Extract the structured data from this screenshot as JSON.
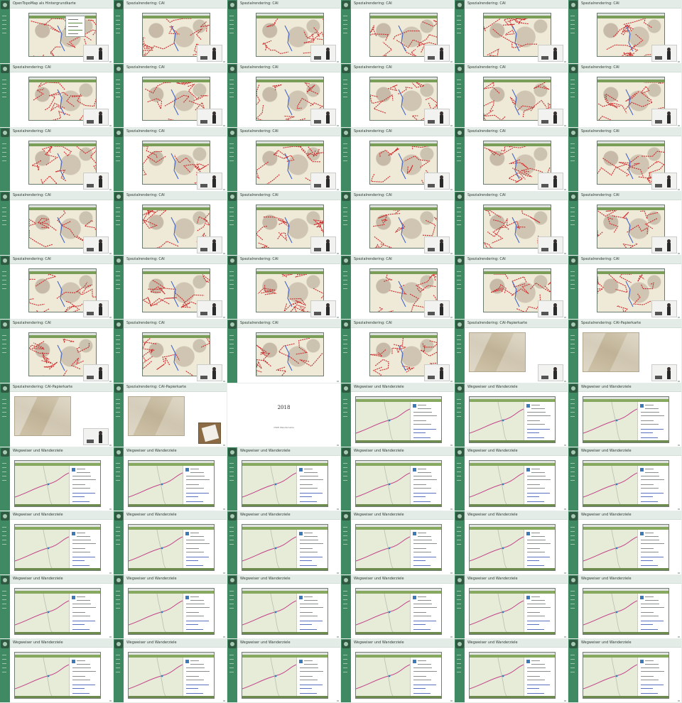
{
  "contact_sheet": {
    "slides": [
      {
        "title": "OpenTopoMap als Hintergrundkarte",
        "kind": "map-legend"
      },
      {
        "title": "Spezialrendering: CAI",
        "kind": "map"
      },
      {
        "title": "Spezialrendering: CAI",
        "kind": "map"
      },
      {
        "title": "Spezialrendering: CAI",
        "kind": "map"
      },
      {
        "title": "Spezialrendering: CAI",
        "kind": "map"
      },
      {
        "title": "Spezialrendering: CAI",
        "kind": "map"
      },
      {
        "title": "Spezialrendering: CAI",
        "kind": "map"
      },
      {
        "title": "Spezialrendering: CAI",
        "kind": "map"
      },
      {
        "title": "Spezialrendering: CAI",
        "kind": "map"
      },
      {
        "title": "Spezialrendering: CAI",
        "kind": "map"
      },
      {
        "title": "Spezialrendering: CAI",
        "kind": "map"
      },
      {
        "title": "Spezialrendering: CAI",
        "kind": "map"
      },
      {
        "title": "Spezialrendering: CAI",
        "kind": "map"
      },
      {
        "title": "Spezialrendering: CAI",
        "kind": "map"
      },
      {
        "title": "Spezialrendering: CAI",
        "kind": "map"
      },
      {
        "title": "Spezialrendering: CAI",
        "kind": "map"
      },
      {
        "title": "Spezialrendering: CAI",
        "kind": "map"
      },
      {
        "title": "Spezialrendering: CAI",
        "kind": "map"
      },
      {
        "title": "Spezialrendering: CAI",
        "kind": "map"
      },
      {
        "title": "Spezialrendering: CAI",
        "kind": "map"
      },
      {
        "title": "Spezialrendering: CAI",
        "kind": "map"
      },
      {
        "title": "Spezialrendering: CAI",
        "kind": "map"
      },
      {
        "title": "Spezialrendering: CAI",
        "kind": "map"
      },
      {
        "title": "Spezialrendering: CAI",
        "kind": "map"
      },
      {
        "title": "Spezialrendering: CAI",
        "kind": "map"
      },
      {
        "title": "Spezialrendering: CAI",
        "kind": "map"
      },
      {
        "title": "Spezialrendering: CAI",
        "kind": "map"
      },
      {
        "title": "Spezialrendering: CAI",
        "kind": "map"
      },
      {
        "title": "Spezialrendering: CAI",
        "kind": "map"
      },
      {
        "title": "Spezialrendering: CAI",
        "kind": "map"
      },
      {
        "title": "Spezialrendering: CAI",
        "kind": "map"
      },
      {
        "title": "Spezialrendering: CAI",
        "kind": "map"
      },
      {
        "title": "Spezialrendering: CAI",
        "kind": "map-novideo"
      },
      {
        "title": "Spezialrendering: CAI",
        "kind": "map"
      },
      {
        "title": "Spezialrendering: CAI-Papierkarte",
        "kind": "paper"
      },
      {
        "title": "Spezialrendering: CAI-Papierkarte",
        "kind": "paper"
      },
      {
        "title": "Spezialrendering: CAI-Papierkarte",
        "kind": "paper"
      },
      {
        "title": "Spezialrendering: CAI-Papierkarte",
        "kind": "paper-novideo"
      },
      {
        "title": "",
        "kind": "titlecard",
        "year": "2018",
        "subtitle": "OSMI Wandernetze"
      },
      {
        "title": "Wegweiser und Wanderziele",
        "kind": "app"
      },
      {
        "title": "Wegweiser und Wanderziele",
        "kind": "app"
      },
      {
        "title": "Wegweiser und Wanderziele",
        "kind": "app"
      },
      {
        "title": "Wegweiser und Wanderziele",
        "kind": "app"
      },
      {
        "title": "Wegweiser und Wanderziele",
        "kind": "app"
      },
      {
        "title": "Wegweiser und Wanderziele",
        "kind": "app"
      },
      {
        "title": "Wegweiser und Wanderziele",
        "kind": "app"
      },
      {
        "title": "Wegweiser und Wanderziele",
        "kind": "app"
      },
      {
        "title": "Wegweiser und Wanderziele",
        "kind": "app"
      },
      {
        "title": "Wegweiser und Wanderziele",
        "kind": "app"
      },
      {
        "title": "Wegweiser und Wanderziele",
        "kind": "app"
      },
      {
        "title": "Wegweiser und Wanderziele",
        "kind": "app"
      },
      {
        "title": "Wegweiser und Wanderziele",
        "kind": "app"
      },
      {
        "title": "Wegweiser und Wanderziele",
        "kind": "app"
      },
      {
        "title": "Wegweiser und Wanderziele",
        "kind": "app"
      },
      {
        "title": "Wegweiser und Wanderziele",
        "kind": "app"
      },
      {
        "title": "Wegweiser und Wanderziele",
        "kind": "app"
      },
      {
        "title": "Wegweiser und Wanderziele",
        "kind": "app"
      },
      {
        "title": "Wegweiser und Wanderziele",
        "kind": "app"
      },
      {
        "title": "Wegweiser und Wanderziele",
        "kind": "app"
      },
      {
        "title": "Wegweiser und Wanderziele",
        "kind": "app"
      },
      {
        "title": "Wegweiser und Wanderziele",
        "kind": "app"
      },
      {
        "title": "Wegweiser und Wanderziele",
        "kind": "app"
      },
      {
        "title": "Wegweiser und Wanderziele",
        "kind": "app"
      },
      {
        "title": "Wegweiser und Wanderziele",
        "kind": "app"
      },
      {
        "title": "Wegweiser und Wanderziele",
        "kind": "app"
      },
      {
        "title": "Wegweiser und Wanderziele",
        "kind": "app"
      }
    ]
  },
  "colors": {
    "sidebar": "#3f8a63",
    "header": "#e4ece7",
    "route_red": "#cc2a2a",
    "route_blue": "#3b5fc4",
    "route_pink": "#c2408a"
  }
}
